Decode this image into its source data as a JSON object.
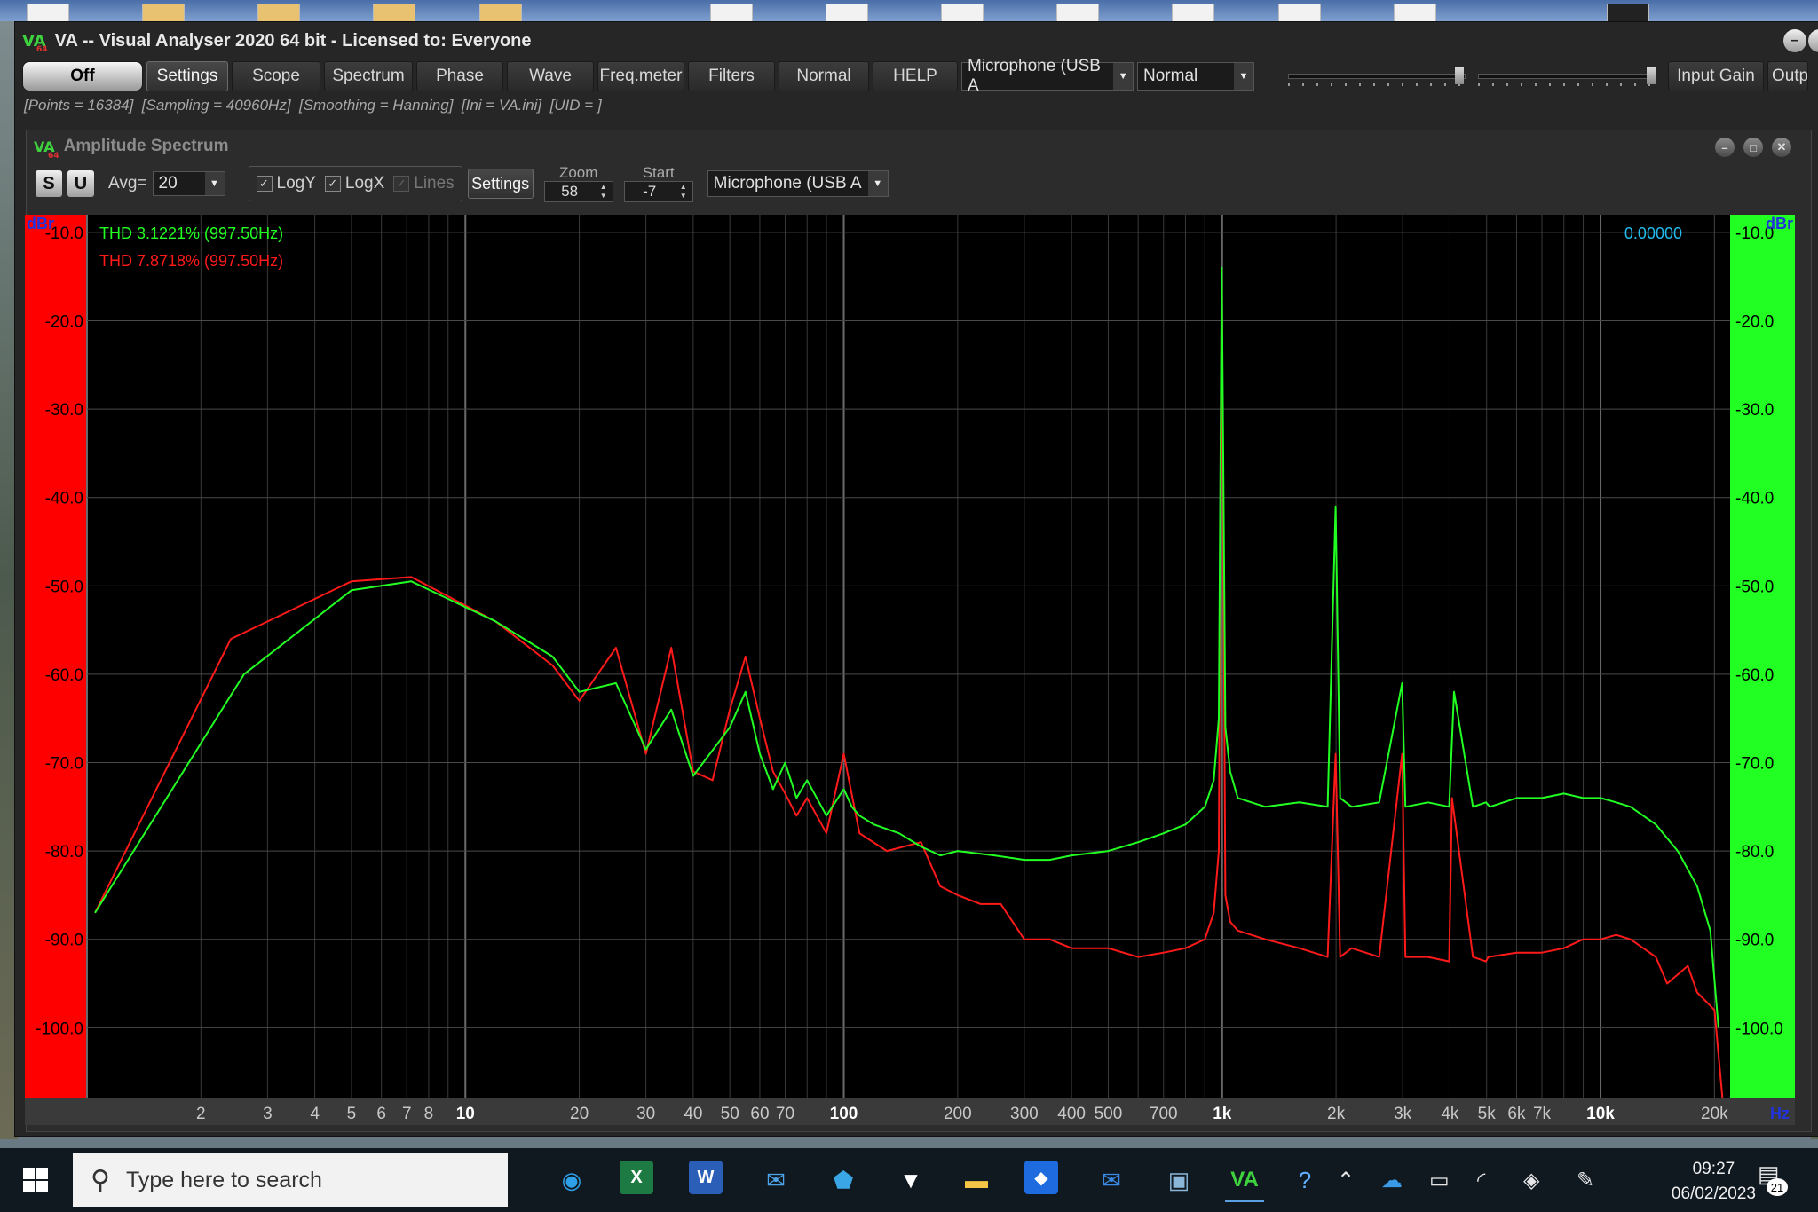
{
  "window": {
    "logo": "VA",
    "title": "VA -- Visual Analyser 2020 64 bit - Licensed to: Everyone"
  },
  "toolbar": {
    "off": "Off",
    "settings": "Settings",
    "scope": "Scope",
    "spectrum": "Spectrum",
    "phase": "Phase",
    "wave": "Wave",
    "freq_meter": "Freq.meter",
    "filters": "Filters",
    "normal_button": "Normal",
    "help": "HELP",
    "input_device": "Microphone (USB A",
    "mode": "Normal",
    "input_gain": "Input Gain",
    "output": "Outp"
  },
  "status": {
    "points": "[Points = 16384]",
    "sampling": "[Sampling = 40960Hz]",
    "smoothing": "[Smoothing = Hanning]",
    "ini": "[Ini = VA.ini]",
    "uid": "[UID = ]"
  },
  "spectrum_window": {
    "title": "Amplitude Spectrum",
    "s_button": "S",
    "u_button": "U",
    "avg_label": "Avg=",
    "avg_value": "20",
    "logy": "LogY",
    "logx": "LogX",
    "lines": "Lines",
    "settings": "Settings",
    "zoom_label": "Zoom",
    "zoom_value": "58",
    "start_label": "Start",
    "start_value": "-7",
    "device": "Microphone (USB A"
  },
  "chart_data": {
    "type": "line",
    "x_scale": "log",
    "xlim": [
      1,
      22000
    ],
    "ylim": [
      -108,
      -8
    ],
    "grid": true,
    "ylabel_left": "dBr",
    "ylabel_right": "dBr",
    "xunit": "Hz",
    "yticks": [
      "-10.0",
      "-20.0",
      "-30.0",
      "-40.0",
      "-50.0",
      "-60.0",
      "-70.0",
      "-80.0",
      "-90.0",
      "-100.0"
    ],
    "ytick_values": [
      -10,
      -20,
      -30,
      -40,
      -50,
      -60,
      -70,
      -80,
      -90,
      -100
    ],
    "xticks": [
      {
        "v": 2,
        "l": "2"
      },
      {
        "v": 3,
        "l": "3"
      },
      {
        "v": 4,
        "l": "4"
      },
      {
        "v": 5,
        "l": "5"
      },
      {
        "v": 6,
        "l": "6"
      },
      {
        "v": 7,
        "l": "7"
      },
      {
        "v": 8,
        "l": "8"
      },
      {
        "v": 10,
        "l": "10"
      },
      {
        "v": 20,
        "l": "20"
      },
      {
        "v": 30,
        "l": "30"
      },
      {
        "v": 40,
        "l": "40"
      },
      {
        "v": 50,
        "l": "50"
      },
      {
        "v": 60,
        "l": "60"
      },
      {
        "v": 70,
        "l": "70"
      },
      {
        "v": 100,
        "l": "100"
      },
      {
        "v": 200,
        "l": "200"
      },
      {
        "v": 300,
        "l": "300"
      },
      {
        "v": 400,
        "l": "400"
      },
      {
        "v": 500,
        "l": "500"
      },
      {
        "v": 700,
        "l": "700"
      },
      {
        "v": 1000,
        "l": "1k"
      },
      {
        "v": 2000,
        "l": "2k"
      },
      {
        "v": 3000,
        "l": "3k"
      },
      {
        "v": 4000,
        "l": "4k"
      },
      {
        "v": 5000,
        "l": "5k"
      },
      {
        "v": 6000,
        "l": "6k"
      },
      {
        "v": 7000,
        "l": "7k"
      },
      {
        "v": 10000,
        "l": "10k"
      },
      {
        "v": 20000,
        "l": "20k"
      }
    ],
    "readout": "0.00000",
    "colors": {
      "green": "#22ff22",
      "red": "#ff1a1a",
      "readout": "#22bbee",
      "left_bar": "#ff0000",
      "right_bar": "#22ff22"
    },
    "series": [
      {
        "name": "THD 3.1221% (997.50Hz)",
        "color": "#22ff22",
        "x": [
          1.05,
          2.6,
          5.0,
          7.2,
          12,
          17,
          20,
          25,
          30,
          35,
          40,
          50,
          55,
          60,
          65,
          70,
          75,
          80,
          90,
          100,
          105,
          110,
          120,
          140,
          160,
          180,
          200,
          250,
          300,
          350,
          400,
          500,
          600,
          700,
          800,
          900,
          950,
          980,
          997.5,
          1020,
          1050,
          1100,
          1300,
          1600,
          1900,
          1995,
          2050,
          2200,
          2600,
          2990,
          3050,
          3500,
          3980,
          4100,
          4600,
          4980,
          5100,
          6000,
          7000,
          8000,
          9000,
          10000,
          11000,
          12000,
          14000,
          16000,
          18000,
          19500,
          20500
        ],
        "y": [
          -87,
          -60,
          -50.5,
          -49.5,
          -54,
          -58,
          -62,
          -61,
          -68.5,
          -64,
          -71.5,
          -66,
          -62,
          -69,
          -73,
          -70,
          -74,
          -72,
          -76,
          -73,
          -75,
          -76,
          -77,
          -78,
          -79.5,
          -80.5,
          -80,
          -80.5,
          -81,
          -81,
          -80.5,
          -80,
          -79,
          -78,
          -77,
          -75,
          -72,
          -65,
          -14,
          -66,
          -71,
          -74,
          -75,
          -74.5,
          -75,
          -41,
          -74,
          -75,
          -74.5,
          -61,
          -75,
          -74.5,
          -75,
          -62,
          -75,
          -74.5,
          -75,
          -74,
          -74,
          -73.5,
          -74,
          -74,
          -74.5,
          -75,
          -77,
          -80,
          -84,
          -89,
          -100
        ]
      },
      {
        "name": "THD 7.8718% (997.50Hz)",
        "color": "#ff1a1a",
        "x": [
          1.05,
          2.4,
          5.0,
          7.2,
          12,
          17,
          20,
          25,
          30,
          35,
          40,
          45,
          50,
          55,
          60,
          65,
          70,
          75,
          80,
          90,
          100,
          110,
          130,
          160,
          180,
          200,
          230,
          260,
          300,
          350,
          400,
          500,
          600,
          700,
          800,
          900,
          950,
          980,
          997.5,
          1020,
          1050,
          1100,
          1300,
          1600,
          1900,
          1995,
          2050,
          2200,
          2600,
          2990,
          3050,
          3500,
          3980,
          4050,
          4600,
          4980,
          5050,
          6000,
          7000,
          8000,
          9000,
          10000,
          11000,
          12000,
          14000,
          15000,
          17000,
          18000,
          20000,
          21000
        ],
        "y": [
          -87,
          -56,
          -49.5,
          -49,
          -54,
          -59,
          -63,
          -57,
          -69,
          -57,
          -71,
          -72,
          -64,
          -58,
          -65,
          -71,
          -73.5,
          -76,
          -74,
          -78,
          -69,
          -78,
          -80,
          -79,
          -84,
          -85,
          -86,
          -86,
          -90,
          -90,
          -91,
          -91,
          -92,
          -91.5,
          -91,
          -90,
          -87,
          -80,
          -15,
          -85,
          -88,
          -89,
          -90,
          -91,
          -92,
          -69,
          -92,
          -91,
          -92,
          -69,
          -92,
          -92,
          -92.5,
          -74,
          -92,
          -92.5,
          -92,
          -91.5,
          -91.5,
          -91,
          -90,
          -90,
          -89.5,
          -90,
          -92,
          -95,
          -93,
          -96,
          -98,
          -108
        ]
      }
    ]
  },
  "taskbar": {
    "search_placeholder": "Type here to search",
    "time": "09:27",
    "date": "06/02/2023",
    "notifications": "21",
    "va_icon": "VA"
  }
}
